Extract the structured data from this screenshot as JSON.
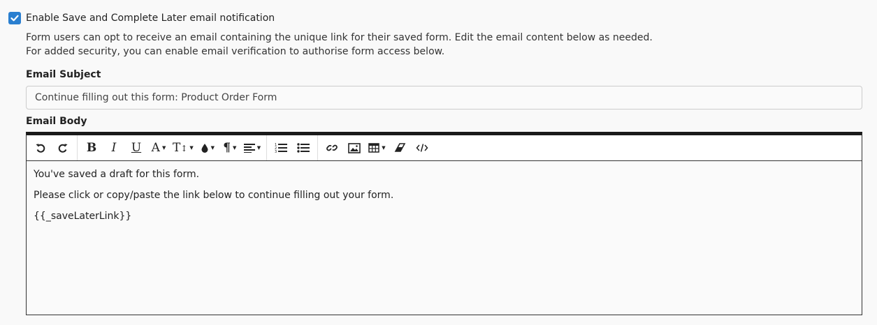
{
  "notification": {
    "checkbox_label": "Enable Save and Complete Later email notification",
    "checked": true,
    "help_line_1": "Form users can opt to receive an email containing the unique link for their saved form. Edit the email content below as needed.",
    "help_line_2": "For added security, you can enable email verification to authorise form access below."
  },
  "email_subject": {
    "label": "Email Subject",
    "value": "Continue filling out this form: Product Order Form"
  },
  "email_body": {
    "label": "Email Body",
    "toolbar": {
      "groups": [
        [
          "undo-icon",
          "redo-icon"
        ],
        [
          "bold-icon",
          "italic-icon",
          "underline-icon",
          "font-family-icon",
          "font-size-icon",
          "color-icon",
          "paragraph-style-icon",
          "align-icon"
        ],
        [
          "ordered-list-icon",
          "unordered-list-icon"
        ],
        [
          "link-icon",
          "image-icon",
          "table-icon",
          "eraser-icon",
          "code-view-icon"
        ]
      ]
    },
    "paragraphs": [
      "You've saved a draft for this form.",
      "Please click or copy/paste the link below to continue filling out your form.",
      "{{_saveLaterLink}}"
    ]
  },
  "colors": {
    "checkbox": "#2a7fd0",
    "editor_border": "#1a1a1a",
    "background": "#f9f9f9"
  }
}
